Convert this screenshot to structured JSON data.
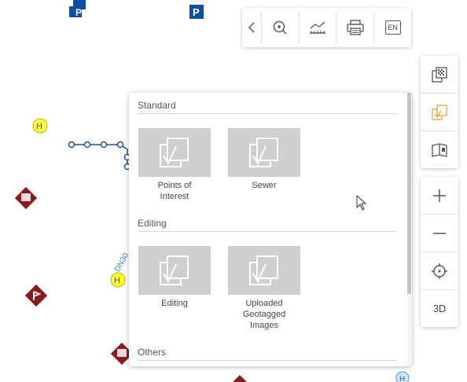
{
  "toolbar": {
    "items": [
      {
        "name": "back",
        "icon": "chevron-left-icon"
      },
      {
        "name": "zoom-to",
        "icon": "zoom-target-icon"
      },
      {
        "name": "measure",
        "icon": "measure-icon"
      },
      {
        "name": "print",
        "icon": "printer-icon"
      },
      {
        "name": "language",
        "icon": "language-icon",
        "label": "EN"
      }
    ]
  },
  "side_panel_top": {
    "items": [
      {
        "name": "basemap",
        "icon": "basemap-layers-icon"
      },
      {
        "name": "layers",
        "icon": "layer-stack-icon",
        "active": true
      },
      {
        "name": "legend",
        "icon": "book-map-icon"
      }
    ]
  },
  "side_panel_bottom": {
    "items": [
      {
        "name": "zoom-in",
        "icon": "plus-icon"
      },
      {
        "name": "zoom-out",
        "icon": "minus-icon"
      },
      {
        "name": "locate",
        "icon": "crosshair-icon"
      },
      {
        "name": "3d",
        "label": "3D"
      }
    ]
  },
  "layer_panel": {
    "sections": [
      {
        "title": "Standard",
        "tiles": [
          {
            "label": "Points of\nInterest"
          },
          {
            "label": "Sewer"
          }
        ]
      },
      {
        "title": "Editing",
        "tiles": [
          {
            "label": "Editing"
          },
          {
            "label": "Uploaded\nGeotagged\nImages"
          }
        ]
      },
      {
        "title": "Others",
        "tiles": []
      }
    ]
  },
  "map": {
    "parking_label": "P",
    "hydrant_label": "H",
    "pipe_label": "DN30"
  },
  "colors": {
    "accent": "#e8a33b",
    "parking": "#0b4ea2",
    "poi": "#8b1a1a",
    "hydrant": "#ffff33",
    "pipe": "#1d4fa0"
  }
}
